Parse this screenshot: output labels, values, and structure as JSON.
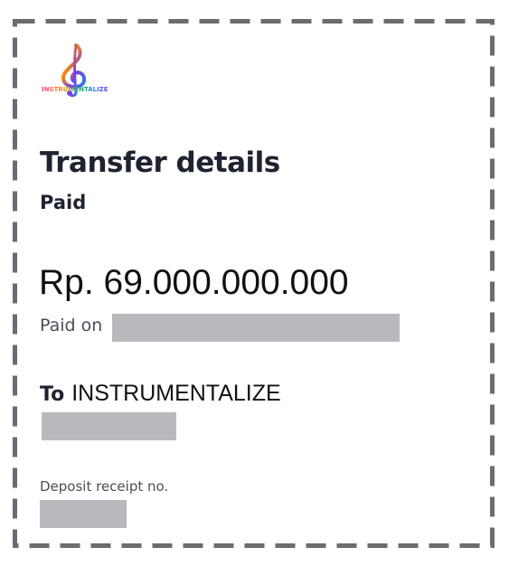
{
  "brand": {
    "logo_text": "INSTRUMENTALIZE",
    "logo_icon": "treble-clef-icon"
  },
  "transfer": {
    "title": "Transfer details",
    "status": "Paid",
    "amount": "Rp. 69.000.000.000",
    "paid_on_label": "Paid on",
    "to_label": "To",
    "to_name": "INSTRUMENTALIZE",
    "deposit_receipt_label": "Deposit receipt no."
  },
  "colors": {
    "border": "#6b6b70",
    "heading": "#1f2330",
    "muted": "#4a4e59",
    "redaction": "#b9b9bd"
  }
}
